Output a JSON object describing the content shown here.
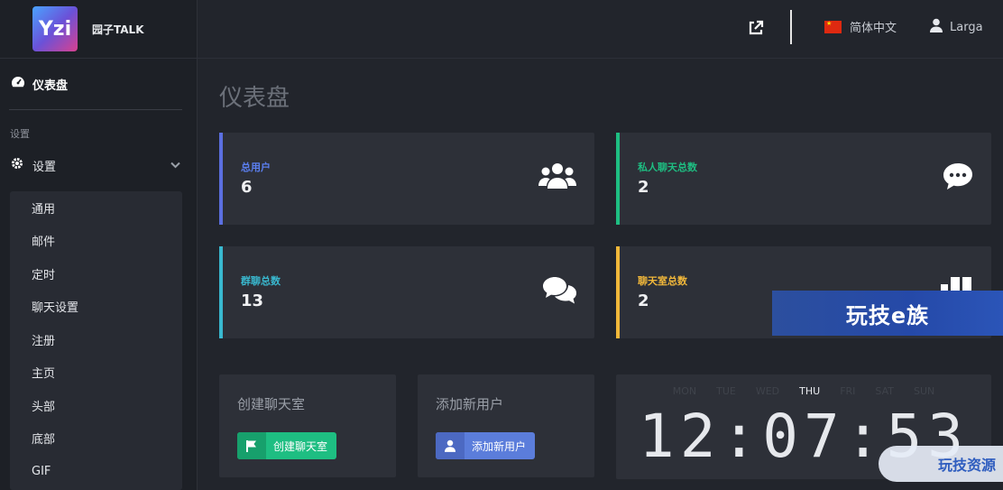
{
  "brand": {
    "logo_text": "Yzi",
    "name": "园子TALK"
  },
  "header": {
    "external_link_icon": "external-link-icon",
    "language": "简体中文",
    "user": "Larga"
  },
  "sidebar": {
    "dashboard": "仪表盘",
    "section_label": "设置",
    "settings": "设置",
    "submenu": [
      "通用",
      "邮件",
      "定时",
      "聊天设置",
      "注册",
      "主页",
      "头部",
      "底部",
      "GIF"
    ]
  },
  "page": {
    "title": "仪表盘"
  },
  "stats": [
    {
      "label": "总用户",
      "value": "6",
      "color": "#5b6fe0",
      "icon": "users-icon"
    },
    {
      "label": "私人聊天总数",
      "value": "2",
      "color": "#1ebe82",
      "icon": "comment-icon"
    },
    {
      "label": "群聊总数",
      "value": "13",
      "color": "#39b8cf",
      "icon": "comments-icon"
    },
    {
      "label": "聊天室总数",
      "value": "2",
      "color": "#f2b83a",
      "icon": "chatroom-icon"
    }
  ],
  "actions": {
    "create_room": {
      "title": "创建聊天室",
      "button": "创建聊天室"
    },
    "add_user": {
      "title": "添加新用户",
      "button": "添加新用户"
    }
  },
  "clock": {
    "days": [
      "MON",
      "TUE",
      "WED",
      "THU",
      "FRI",
      "SAT",
      "SUN"
    ],
    "active_day": "THU",
    "time": "12:07:53"
  },
  "watermarks": {
    "top": "玩技e族",
    "bottom": "玩技资源"
  }
}
